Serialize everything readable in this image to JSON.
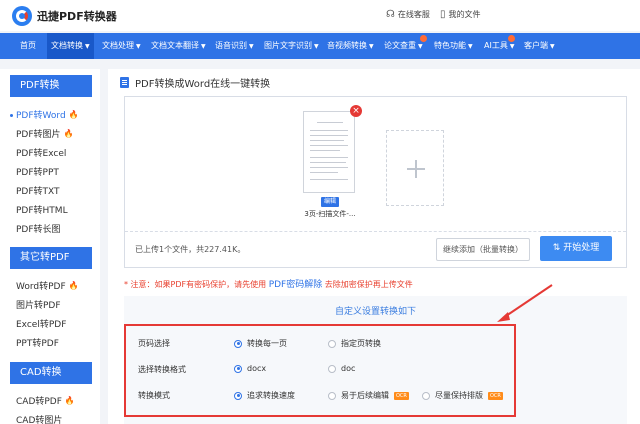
{
  "header": {
    "brand": "迅捷PDF转换器",
    "service": "在线客服",
    "my_files": "我的文件"
  },
  "nav": {
    "items": [
      {
        "label": "首页"
      },
      {
        "label": "文档转换",
        "active": true
      },
      {
        "label": "文档处理"
      },
      {
        "label": "文档文本翻译"
      },
      {
        "label": "语音识别"
      },
      {
        "label": "图片文字识别"
      },
      {
        "label": "音视频转换"
      },
      {
        "label": "论文查重"
      },
      {
        "label": "特色功能"
      },
      {
        "label": "AI工具"
      },
      {
        "label": "客户端"
      }
    ]
  },
  "sidebar": {
    "groups": [
      {
        "title": "PDF转换",
        "items": [
          "PDF转Word",
          "PDF转图片",
          "PDF转Excel",
          "PDF转PPT",
          "PDF转TXT",
          "PDF转HTML",
          "PDF转长图"
        ]
      },
      {
        "title": "其它转PDF",
        "items": [
          "Word转PDF",
          "图片转PDF",
          "Excel转PDF",
          "PPT转PDF"
        ]
      },
      {
        "title": "CAD转换",
        "items": [
          "CAD转PDF",
          "CAD转图片"
        ]
      }
    ]
  },
  "main": {
    "title": "PDF转换成Word在线一键转换",
    "file": {
      "edit_tag": "编辑",
      "name": "3页-扫描文件-..."
    },
    "upload_info": "已上传1个文件，共227.41K。",
    "add_more_button": "继续添加（批量转换）",
    "start_button": "开始处理",
    "notice_prefix": "* 注意：如果PDF有密码保护，请先使用",
    "notice_link": "PDF密码解除",
    "notice_suffix": "去除加密保护再上传文件"
  },
  "settings": {
    "title": "自定义设置转换如下",
    "page_label": "页码选择",
    "page_options": [
      "转换每一页",
      "指定页转换"
    ],
    "format_label": "选择转换格式",
    "format_options": [
      "docx",
      "doc"
    ],
    "mode_label": "转换模式",
    "mode_options": [
      "追求转换速度",
      "易于后续编辑",
      "尽量保持排版"
    ],
    "ocr_tag": "OCR"
  },
  "colors": {
    "accent": "#2f73e6",
    "highlight": "#e53935",
    "warning": "#e8402f"
  }
}
